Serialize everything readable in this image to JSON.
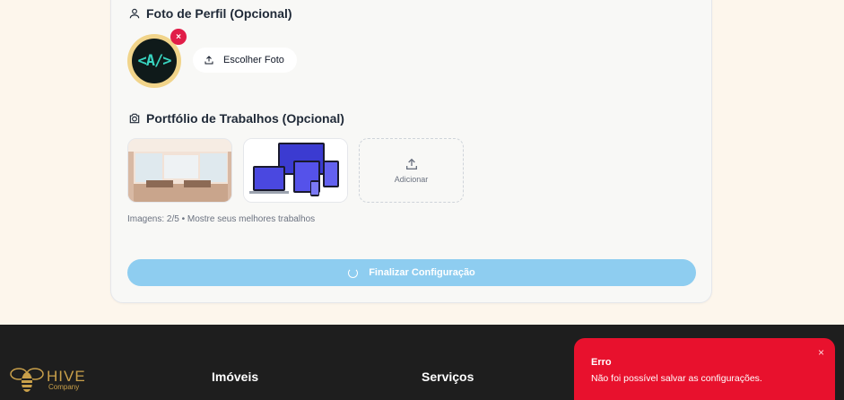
{
  "profile": {
    "section_title": "Foto de Perfil (Opcional)",
    "avatar_text": "<A/>",
    "remove_icon": "×",
    "choose_label": "Escolher Foto"
  },
  "portfolio": {
    "section_title": "Portfólio de Trabalhos (Opcional)",
    "thumbnails": [
      "photo-office",
      "photo-devices"
    ],
    "add_label": "Adicionar",
    "hint": "Imagens: 2/5 • Mostre seus melhores trabalhos"
  },
  "actions": {
    "finish_label": "Finalizar Configuração"
  },
  "footer": {
    "logo_name": "HIVE",
    "logo_sub": "Company",
    "col1_title": "Imóveis",
    "col2_title": "Serviços"
  },
  "toast": {
    "title": "Erro",
    "message": "Não foi possível salvar as configurações.",
    "close_icon": "×"
  },
  "colors": {
    "accent_blue": "#8ecdf0",
    "error_red": "#e8112d",
    "brand_gold": "#c9a04a"
  }
}
